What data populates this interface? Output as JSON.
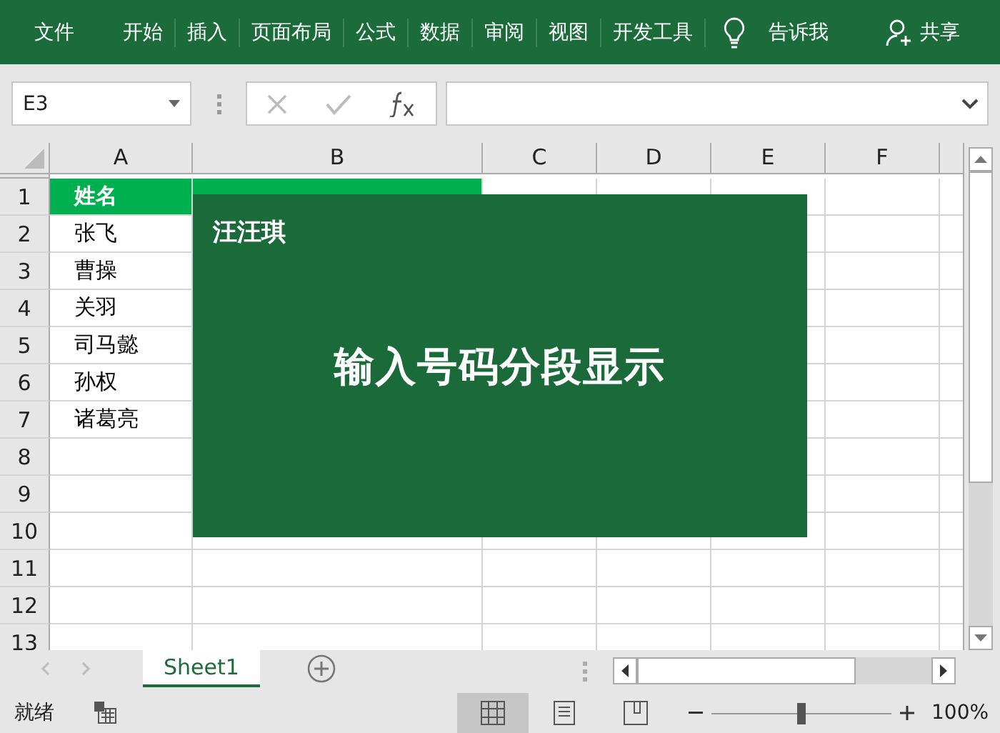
{
  "ribbon_tabs": [
    {
      "label": "文件"
    },
    {
      "label": "开始"
    },
    {
      "label": "插入"
    },
    {
      "label": "页面布局"
    },
    {
      "label": "公式"
    },
    {
      "label": "数据"
    },
    {
      "label": "审阅"
    },
    {
      "label": "视图"
    },
    {
      "label": "开发工具"
    }
  ],
  "tell_me": "告诉我",
  "share": "共享",
  "name_box": "E3",
  "columns": [
    {
      "label": "A"
    },
    {
      "label": "B"
    },
    {
      "label": "C"
    },
    {
      "label": "D"
    },
    {
      "label": "E"
    },
    {
      "label": "F"
    }
  ],
  "rows": [
    {
      "number": "1",
      "kind": "header",
      "cells": [
        "姓名"
      ]
    },
    {
      "number": "2",
      "kind": "data",
      "cells": [
        "张飞"
      ]
    },
    {
      "number": "3",
      "kind": "data",
      "cells": [
        "曹操"
      ]
    },
    {
      "number": "4",
      "kind": "data",
      "cells": [
        "关羽"
      ]
    },
    {
      "number": "5",
      "kind": "data",
      "cells": [
        "司马懿"
      ]
    },
    {
      "number": "6",
      "kind": "data",
      "cells": [
        "孙权"
      ]
    },
    {
      "number": "7",
      "kind": "data",
      "cells": [
        "诸葛亮"
      ]
    },
    {
      "number": "8",
      "kind": "data",
      "cells": []
    },
    {
      "number": "9",
      "kind": "data",
      "cells": []
    },
    {
      "number": "10",
      "kind": "data",
      "cells": []
    },
    {
      "number": "11",
      "kind": "data",
      "cells": []
    },
    {
      "number": "12",
      "kind": "data",
      "cells": []
    },
    {
      "number": "13",
      "kind": "data",
      "cells": []
    }
  ],
  "banner": {
    "author": "汪汪琪",
    "headline": "输入号码分段显示"
  },
  "sheet_tabs": [
    {
      "label": "Sheet1",
      "selected": true
    }
  ],
  "status": "就绪",
  "views": [
    {
      "kind": "normal",
      "selected": true
    },
    {
      "kind": "page-layout",
      "selected": false
    },
    {
      "kind": "page-break",
      "selected": false
    }
  ],
  "zoom": {
    "level": 0.5,
    "reading": "100%"
  }
}
